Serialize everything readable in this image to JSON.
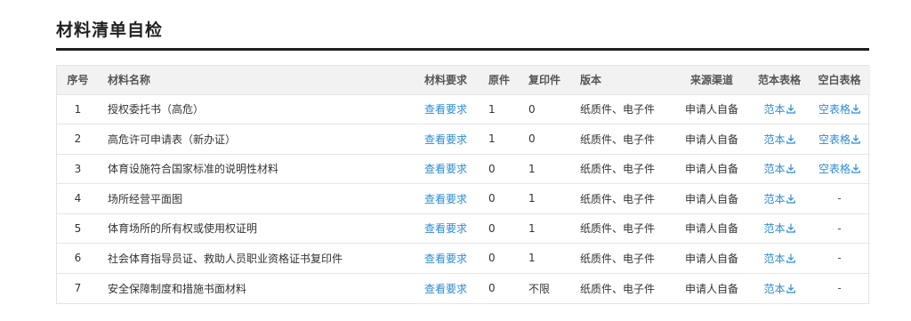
{
  "page": {
    "title": "材料清单自检"
  },
  "table": {
    "headers": {
      "no": "序号",
      "name": "材料名称",
      "requirement": "材料要求",
      "original": "原件",
      "copy": "复印件",
      "version": "版本",
      "source": "来源渠道",
      "sample": "范本表格",
      "blank": "空白表格"
    },
    "rows": [
      {
        "no": "1",
        "name": "授权委托书（高危）",
        "requirement": "查看要求",
        "original": "1",
        "copy": "0",
        "version": "纸质件、电子件",
        "source": "申请人自备",
        "sample": "范本",
        "blank": "空表格"
      },
      {
        "no": "2",
        "name": "高危许可申请表（新办证）",
        "requirement": "查看要求",
        "original": "1",
        "copy": "0",
        "version": "纸质件、电子件",
        "source": "申请人自备",
        "sample": "范本",
        "blank": "空表格"
      },
      {
        "no": "3",
        "name": "体育设施符合国家标准的说明性材料",
        "requirement": "查看要求",
        "original": "0",
        "copy": "1",
        "version": "纸质件、电子件",
        "source": "申请人自备",
        "sample": "范本",
        "blank": "空表格"
      },
      {
        "no": "4",
        "name": "场所经营平面图",
        "requirement": "查看要求",
        "original": "0",
        "copy": "1",
        "version": "纸质件、电子件",
        "source": "申请人自备",
        "sample": "范本",
        "blank": "-"
      },
      {
        "no": "5",
        "name": "体育场所的所有权或使用权证明",
        "requirement": "查看要求",
        "original": "0",
        "copy": "1",
        "version": "纸质件、电子件",
        "source": "申请人自备",
        "sample": "范本",
        "blank": "-"
      },
      {
        "no": "6",
        "name": "社会体育指导员证、救助人员职业资格证书复印件",
        "requirement": "查看要求",
        "original": "0",
        "copy": "1",
        "version": "纸质件、电子件",
        "source": "申请人自备",
        "sample": "范本",
        "blank": "-"
      },
      {
        "no": "7",
        "name": "安全保障制度和措施书面材料",
        "requirement": "查看要求",
        "original": "0",
        "copy": "不限",
        "version": "纸质件、电子件",
        "source": "申请人自备",
        "sample": "范本",
        "blank": "-"
      }
    ]
  },
  "colors": {
    "link": "#2d8cd8",
    "header_bg": "#f2f2f2",
    "title_rule": "#1f1f1f"
  },
  "icons": {
    "download": "download-icon"
  }
}
